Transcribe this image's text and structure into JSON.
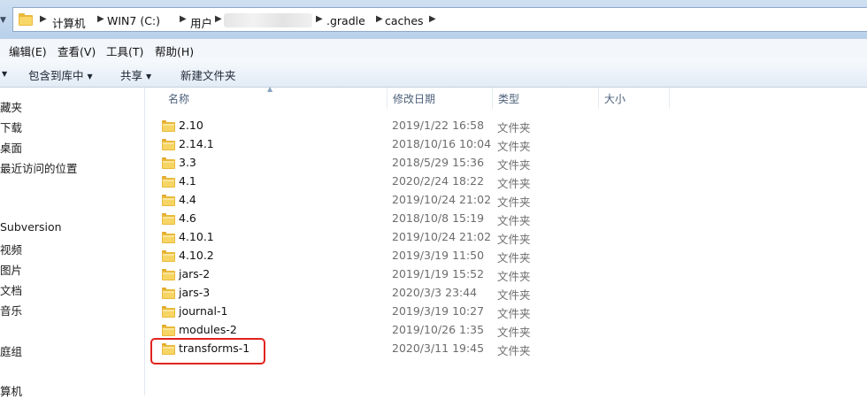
{
  "address": {
    "crumbs": [
      "计算机",
      "WIN7 (C:)",
      "用户",
      ".gradle",
      "caches"
    ]
  },
  "menubar": {
    "items": [
      "编辑(E)",
      "查看(V)",
      "工具(T)",
      "帮助(H)"
    ]
  },
  "toolbar": {
    "items": [
      "包含到库中",
      "共享",
      "新建文件夹"
    ]
  },
  "navpane": {
    "items": [
      "藏夹",
      "下载",
      "桌面",
      "最近访问的位置",
      "Subversion",
      "视频",
      "图片",
      "文档",
      "音乐",
      "庭组",
      "算机"
    ]
  },
  "columns": [
    "名称",
    "修改日期",
    "类型",
    "大小"
  ],
  "files": [
    {
      "name": "2.10",
      "date": "2019/1/22 16:58",
      "type": "文件夹"
    },
    {
      "name": "2.14.1",
      "date": "2018/10/16 10:04",
      "type": "文件夹"
    },
    {
      "name": "3.3",
      "date": "2018/5/29 15:36",
      "type": "文件夹"
    },
    {
      "name": "4.1",
      "date": "2020/2/24 18:22",
      "type": "文件夹"
    },
    {
      "name": "4.4",
      "date": "2019/10/24 21:02",
      "type": "文件夹"
    },
    {
      "name": "4.6",
      "date": "2018/10/8 15:19",
      "type": "文件夹"
    },
    {
      "name": "4.10.1",
      "date": "2019/10/24 21:02",
      "type": "文件夹"
    },
    {
      "name": "4.10.2",
      "date": "2019/3/19 11:50",
      "type": "文件夹"
    },
    {
      "name": "jars-2",
      "date": "2019/1/19 15:52",
      "type": "文件夹"
    },
    {
      "name": "jars-3",
      "date": "2020/3/3 23:44",
      "type": "文件夹"
    },
    {
      "name": "journal-1",
      "date": "2019/3/19 10:27",
      "type": "文件夹"
    },
    {
      "name": "modules-2",
      "date": "2019/10/26 1:35",
      "type": "文件夹"
    },
    {
      "name": "transforms-1",
      "date": "2020/3/11 19:45",
      "type": "文件夹"
    }
  ],
  "icons": {
    "folder": "folder-icon",
    "separator": "chevron-right-icon",
    "dropdown": "chevron-down-icon",
    "sort": "sort-ascending-icon"
  },
  "colors": {
    "highlight": "#e0231f",
    "folder": "#f4c542"
  }
}
